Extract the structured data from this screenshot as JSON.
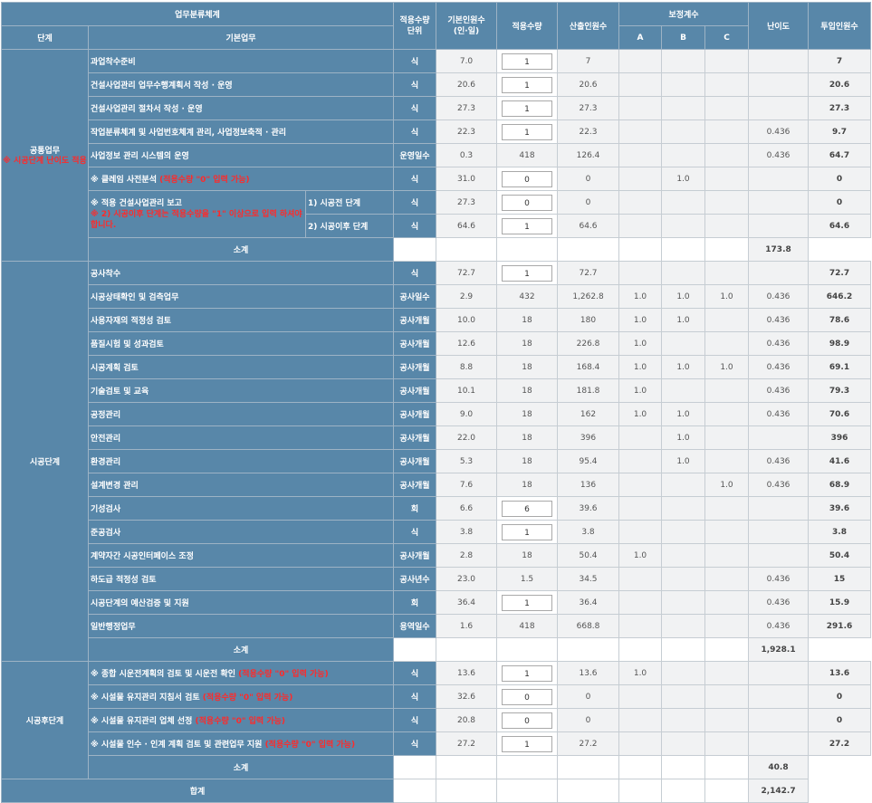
{
  "header": {
    "classification": "업무분류체계",
    "stage": "단계",
    "basic_task": "기본업무",
    "unit": "적용수량\n단위",
    "base_mandays": "기본인원수\n(인·일)",
    "quantity": "적용수량",
    "calc_mandays": "산출인원수",
    "correction": "보정계수",
    "coef_a": "A",
    "coef_b": "B",
    "coef_c": "C",
    "difficulty": "난이도",
    "input_mandays": "투입인원수"
  },
  "stages": {
    "s1": {
      "name": "공통업무",
      "note": "※ 시공단계 난이도 적용"
    },
    "s2": {
      "name": "시공단계"
    },
    "s3": {
      "name": "시공후단계"
    }
  },
  "rows": [
    {
      "title": "과업착수준비",
      "unit": "식",
      "base": "7.0",
      "qty": "1",
      "calc": "7",
      "a": "",
      "b": "",
      "c": "",
      "diff": "",
      "total": "7"
    },
    {
      "title": "건설사업관리 업무수행계획서 작성 · 운영",
      "unit": "식",
      "base": "20.6",
      "qty": "1",
      "calc": "20.6",
      "a": "",
      "b": "",
      "c": "",
      "diff": "",
      "total": "20.6"
    },
    {
      "title": "건설사업관리 절차서 작성 · 운영",
      "unit": "식",
      "base": "27.3",
      "qty": "1",
      "calc": "27.3",
      "a": "",
      "b": "",
      "c": "",
      "diff": "",
      "total": "27.3"
    },
    {
      "title": "작업분류체계 및 사업번호체계 관리, 사업정보축적 · 관리",
      "unit": "식",
      "base": "22.3",
      "qty": "1",
      "calc": "22.3",
      "a": "",
      "b": "",
      "c": "",
      "diff": "0.436",
      "total": "9.7"
    },
    {
      "title": "사업정보 관리 시스템의 운영",
      "unit": "운영일수",
      "base": "0.3",
      "qty": "418",
      "calc": "126.4",
      "a": "",
      "b": "",
      "c": "",
      "diff": "0.436",
      "total": "64.7"
    },
    {
      "title": "※ 클레임 사전분석",
      "note": "(적용수량 \"0\" 입력 가능)",
      "unit": "식",
      "base": "31.0",
      "qty": "0",
      "calc": "0",
      "a": "",
      "b": "1.0",
      "c": "",
      "diff": "",
      "total": "0"
    },
    {
      "title": "※ 적용 건설사업관리 보고",
      "note": "※ 2) 시공이후 단계는 적용수량을 \"1\" 이상으로 입력 하셔야 합니다.",
      "sub1": "1) 시공전 단계",
      "unit": "식",
      "base": "27.3",
      "qty": "0",
      "calc": "0",
      "a": "",
      "b": "",
      "c": "",
      "diff": "",
      "total": "0"
    },
    {
      "sub2": "2) 시공이후 단계",
      "unit": "식",
      "base": "64.6",
      "qty": "1",
      "calc": "64.6",
      "a": "",
      "b": "",
      "c": "",
      "diff": "",
      "total": "64.6"
    },
    {
      "title": "공사착수",
      "unit": "식",
      "base": "72.7",
      "qty": "1",
      "calc": "72.7",
      "a": "",
      "b": "",
      "c": "",
      "diff": "",
      "total": "72.7"
    },
    {
      "title": "시공상태확인 및 검측업무",
      "unit": "공사일수",
      "base": "2.9",
      "qty": "432",
      "calc": "1,262.8",
      "a": "1.0",
      "b": "1.0",
      "c": "1.0",
      "diff": "0.436",
      "total": "646.2"
    },
    {
      "title": "사용자재의 적정성 검토",
      "unit": "공사개월",
      "base": "10.0",
      "qty": "18",
      "calc": "180",
      "a": "1.0",
      "b": "1.0",
      "c": "",
      "diff": "0.436",
      "total": "78.6"
    },
    {
      "title": "품질시험 및 성과검토",
      "unit": "공사개월",
      "base": "12.6",
      "qty": "18",
      "calc": "226.8",
      "a": "1.0",
      "b": "",
      "c": "",
      "diff": "0.436",
      "total": "98.9"
    },
    {
      "title": "시공계획 검토",
      "unit": "공사개월",
      "base": "8.8",
      "qty": "18",
      "calc": "168.4",
      "a": "1.0",
      "b": "1.0",
      "c": "1.0",
      "diff": "0.436",
      "total": "69.1"
    },
    {
      "title": "기술검토 및 교육",
      "unit": "공사개월",
      "base": "10.1",
      "qty": "18",
      "calc": "181.8",
      "a": "1.0",
      "b": "",
      "c": "",
      "diff": "0.436",
      "total": "79.3"
    },
    {
      "title": "공정관리",
      "unit": "공사개월",
      "base": "9.0",
      "qty": "18",
      "calc": "162",
      "a": "1.0",
      "b": "1.0",
      "c": "",
      "diff": "0.436",
      "total": "70.6"
    },
    {
      "title": "안전관리",
      "unit": "공사개월",
      "base": "22.0",
      "qty": "18",
      "calc": "396",
      "a": "",
      "b": "1.0",
      "c": "",
      "diff": "",
      "total": "396"
    },
    {
      "title": "환경관리",
      "unit": "공사개월",
      "base": "5.3",
      "qty": "18",
      "calc": "95.4",
      "a": "",
      "b": "1.0",
      "c": "",
      "diff": "0.436",
      "total": "41.6"
    },
    {
      "title": "설계변경 관리",
      "unit": "공사개월",
      "base": "7.6",
      "qty": "18",
      "calc": "136",
      "a": "",
      "b": "",
      "c": "1.0",
      "diff": "0.436",
      "total": "68.9"
    },
    {
      "title": "기성검사",
      "unit": "회",
      "base": "6.6",
      "qty": "6",
      "calc": "39.6",
      "a": "",
      "b": "",
      "c": "",
      "diff": "",
      "total": "39.6"
    },
    {
      "title": "준공검사",
      "unit": "식",
      "base": "3.8",
      "qty": "1",
      "calc": "3.8",
      "a": "",
      "b": "",
      "c": "",
      "diff": "",
      "total": "3.8"
    },
    {
      "title": "계약자간 시공인터페이스 조정",
      "unit": "공사개월",
      "base": "2.8",
      "qty": "18",
      "calc": "50.4",
      "a": "1.0",
      "b": "",
      "c": "",
      "diff": "",
      "total": "50.4"
    },
    {
      "title": "하도급 적정성 검토",
      "unit": "공사년수",
      "base": "23.0",
      "qty": "1.5",
      "calc": "34.5",
      "a": "",
      "b": "",
      "c": "",
      "diff": "0.436",
      "total": "15"
    },
    {
      "title": "시공단계의 예산검증 및 지원",
      "unit": "회",
      "base": "36.4",
      "qty": "1",
      "calc": "36.4",
      "a": "",
      "b": "",
      "c": "",
      "diff": "0.436",
      "total": "15.9"
    },
    {
      "title": "일반행정업무",
      "unit": "용역일수",
      "base": "1.6",
      "qty": "418",
      "calc": "668.8",
      "a": "",
      "b": "",
      "c": "",
      "diff": "0.436",
      "total": "291.6"
    },
    {
      "title": "※ 종합 시운전계획의 검토 및 시운전 확인",
      "note": "(적용수량 \"0\" 입력 가능)",
      "unit": "식",
      "base": "13.6",
      "qty": "1",
      "calc": "13.6",
      "a": "1.0",
      "b": "",
      "c": "",
      "diff": "",
      "total": "13.6"
    },
    {
      "title": "※ 시설물 유지관리 지침서 검토",
      "note": "(적용수량 \"0\" 입력 가능)",
      "unit": "식",
      "base": "32.6",
      "qty": "0",
      "calc": "0",
      "a": "",
      "b": "",
      "c": "",
      "diff": "",
      "total": "0"
    },
    {
      "title": "※ 시설물 유지관리 업체 선정",
      "note": "(적용수량 \"0\" 입력 가능)",
      "unit": "식",
      "base": "20.8",
      "qty": "0",
      "calc": "0",
      "a": "",
      "b": "",
      "c": "",
      "diff": "",
      "total": "0"
    },
    {
      "title": "※ 시설물 인수 · 인계 계획 검토 및 관련업무 지원",
      "note": "(적용수량 \"0\" 입력 가능)",
      "unit": "식",
      "base": "27.2",
      "qty": "1",
      "calc": "27.2",
      "a": "",
      "b": "",
      "c": "",
      "diff": "",
      "total": "27.2"
    }
  ],
  "subtotals": {
    "label": "소계",
    "s1": "173.8",
    "s2": "1,928.1",
    "s3": "40.8"
  },
  "grand_total": {
    "label": "합계",
    "value": "2,142.7"
  },
  "colors": {
    "header_bg": "#5887a9",
    "cell_bg": "#f1f2f3",
    "note_red": "#ff2a2a"
  }
}
